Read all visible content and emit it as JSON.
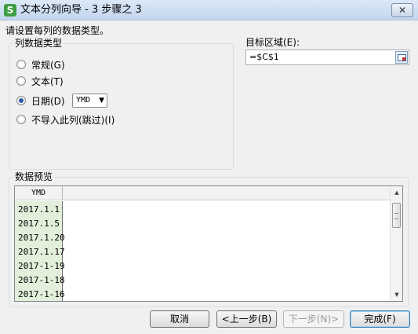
{
  "window": {
    "title": "文本分列向导 - 3 步骤之 3",
    "app_icon": "S",
    "close_icon": "✕"
  },
  "instruction": "请设置每列的数据类型。",
  "column_type": {
    "legend": "列数据类型",
    "options": [
      {
        "label": "常规(G)",
        "checked": false
      },
      {
        "label": "文本(T)",
        "checked": false
      },
      {
        "label": "日期(D)",
        "checked": true
      },
      {
        "label": "不导入此列(跳过)(I)",
        "checked": false
      }
    ],
    "date_format": "YMD",
    "dropdown_arrow": "▼"
  },
  "target": {
    "label": "目标区域(E):",
    "value": "=$C$1",
    "picker_icon": "range-select-icon"
  },
  "preview": {
    "legend": "数据预览",
    "column_header": "YMD",
    "rows": [
      "2017.1.1",
      "2017.1.5",
      "2017.1.20",
      "2017.1.17",
      "2017-1-19",
      "2017-1-18",
      "2017-1-16"
    ],
    "scroll_up": "▲",
    "scroll_down": "▼"
  },
  "buttons": {
    "cancel": "取消",
    "back": "<上一步(B)",
    "next": "下一步(N)>",
    "finish": "完成(F)"
  },
  "colors": {
    "title_bar": "#c4d7ef",
    "date_column_bg": "#e2efda",
    "radio_selected": "#2a5aa8",
    "app_icon": "#3c9e3f"
  }
}
